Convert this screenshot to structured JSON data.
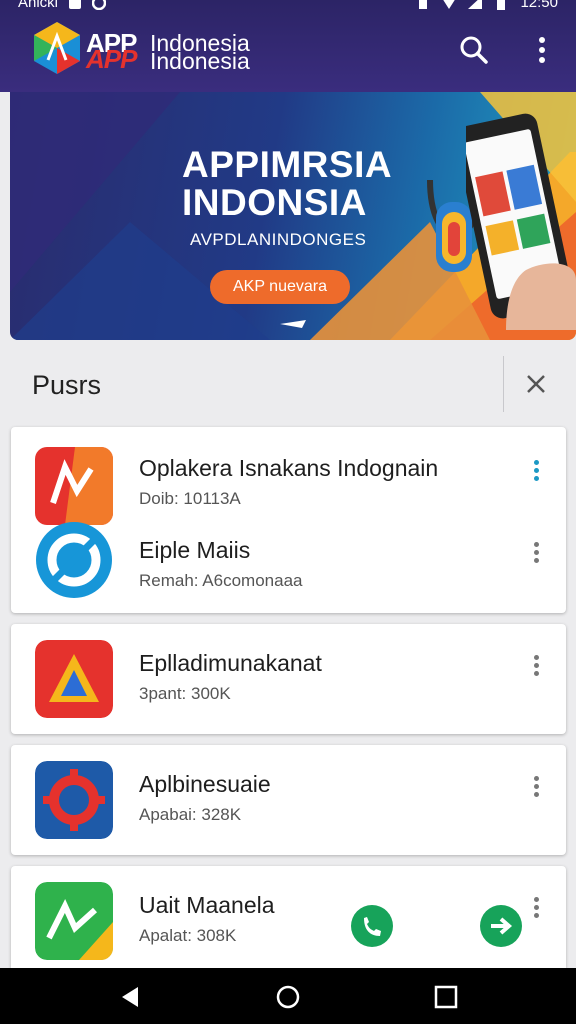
{
  "status_bar": {
    "left_text": "Anicki",
    "time": "12:50"
  },
  "app_bar": {
    "logo_word": "APP",
    "name_line1": "Indonesia",
    "name_line2": "Indonesia",
    "actions": [
      "search-icon",
      "more-vert-icon"
    ]
  },
  "banner": {
    "title_line1": "APPIMRSIA",
    "title_line2": "INDONSIA",
    "subtitle": "AVPDLANINDONGES",
    "cta_label": "AKP nuevara"
  },
  "section": {
    "title": "Pusrs"
  },
  "apps": [
    {
      "name": "Oplakera Isnakans Indognain",
      "sub": "Doib: 10113A"
    },
    {
      "name": "Eiple Maiis",
      "sub": "Remah: A6comonaaa"
    },
    {
      "name": "Eplladimunakanat",
      "sub": "3pant: 300K"
    },
    {
      "name": "Aplbinesuaie",
      "sub": "Apabai: 328K"
    },
    {
      "name": "Uait Maanela",
      "sub": "Apalat: 308K"
    }
  ],
  "colors": {
    "app_bar": "#2c2466",
    "cta": "#ee6b2b",
    "accent_teal": "#1c98c4",
    "fab_green": "#17a35a"
  }
}
